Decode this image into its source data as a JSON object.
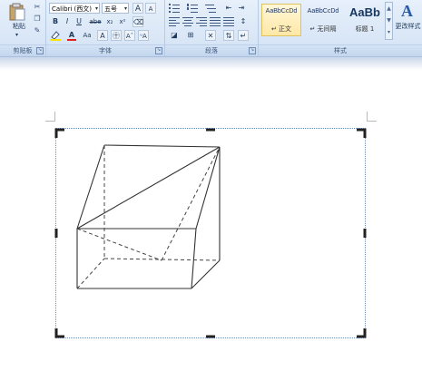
{
  "ribbon": {
    "clipboard": {
      "paste_label": "粘贴",
      "group_label": "剪贴板"
    },
    "font": {
      "font_name": "Calibri (西文)",
      "font_size": "五号",
      "group_label": "字体",
      "buttons": {
        "bold": "B",
        "italic": "I",
        "underline": "U",
        "strike": "abe",
        "subscript": "x₂",
        "superscript": "x²",
        "grow": "A",
        "shrink": "A",
        "font_color": "A",
        "change_case": "Aa",
        "char_border": "A",
        "enclosed": "㊉"
      }
    },
    "paragraph": {
      "group_label": "段落"
    },
    "styles": {
      "group_label": "样式",
      "items": [
        {
          "sample": "AaBbCcDd",
          "name": "↵ 正文",
          "active": true
        },
        {
          "sample": "AaBbCcDd",
          "name": "↵ 无间隔",
          "active": false
        },
        {
          "sample": "AaBb",
          "name": "标题 1",
          "active": false
        }
      ],
      "change_styles_label": "更改样式"
    }
  },
  "colors": {
    "ribbon_bg": "#d3e2f4",
    "font_color_underline": "#e02020",
    "highlight": "#ffe200",
    "frame_border": "#6f8fb8",
    "line": "#333333"
  }
}
